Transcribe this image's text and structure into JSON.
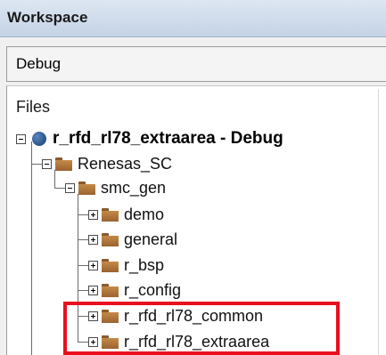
{
  "window": {
    "title": "Workspace"
  },
  "configuration": {
    "selected": "Debug"
  },
  "tree": {
    "header": "Files",
    "project": {
      "label": "r_rfd_rl78_extraarea - Debug",
      "icon": "project-icon"
    },
    "nodes": [
      {
        "label": "Renesas_SC",
        "icon": "folder-icon",
        "expander": "collapse"
      },
      {
        "label": "smc_gen",
        "icon": "folder-icon",
        "expander": "collapse"
      },
      {
        "label": "demo",
        "icon": "folder-icon",
        "expander": "expand"
      },
      {
        "label": "general",
        "icon": "folder-icon",
        "expander": "expand"
      },
      {
        "label": "r_bsp",
        "icon": "folder-icon",
        "expander": "expand"
      },
      {
        "label": "r_config",
        "icon": "folder-icon",
        "expander": "expand"
      },
      {
        "label": "r_rfd_rl78_common",
        "icon": "folder-icon",
        "expander": "expand",
        "highlighted": true
      },
      {
        "label": "r_rfd_rl78_extraarea",
        "icon": "folder-icon",
        "expander": "expand",
        "highlighted": true
      }
    ]
  },
  "colors": {
    "highlight": "#e8101e",
    "folder": "#b57a3c",
    "titlebar": "#c5d3e6"
  }
}
